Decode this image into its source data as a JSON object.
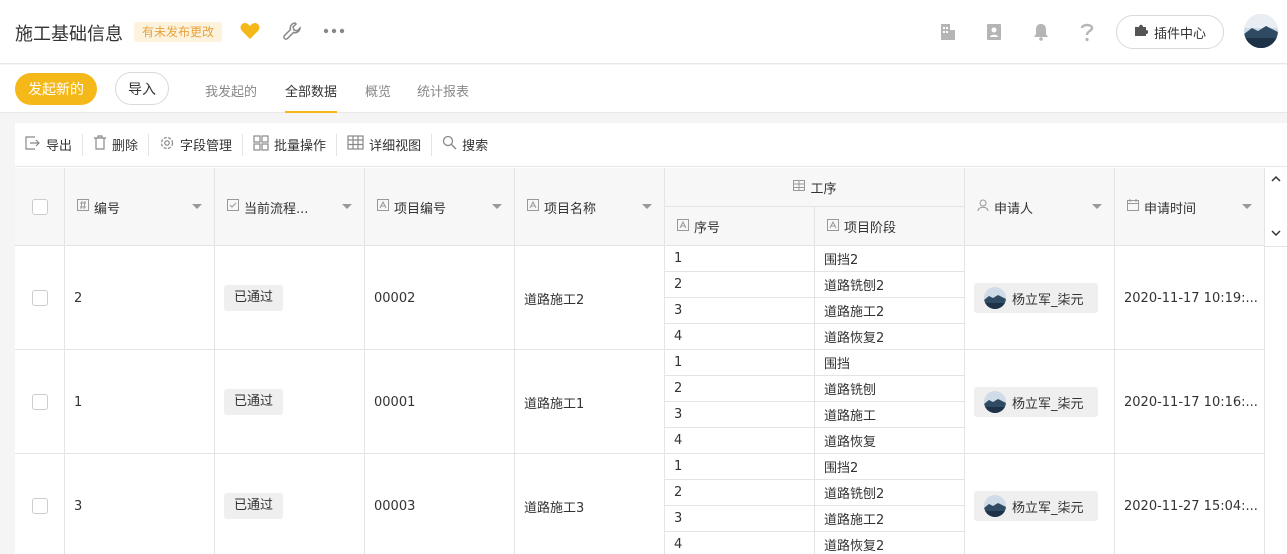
{
  "app": {
    "title": "施工基础信息",
    "badge": "有未发布更改",
    "plugin_label": "插件中心"
  },
  "nav": {
    "new_button": "发起新的",
    "import_button": "导入",
    "tabs": [
      {
        "label": "我发起的",
        "active": false
      },
      {
        "label": "全部数据",
        "active": true
      },
      {
        "label": "概览",
        "active": false
      },
      {
        "label": "统计报表",
        "active": false
      }
    ]
  },
  "toolbar": {
    "export": "导出",
    "delete": "删除",
    "fields": "字段管理",
    "batch": "批量操作",
    "detail_view": "详细视图",
    "search": "搜索"
  },
  "table": {
    "headers": {
      "id": "编号",
      "flow": "当前流程...",
      "project_no": "项目编号",
      "project_name": "项目名称",
      "process": "工序",
      "seq": "序号",
      "stage": "项目阶段",
      "applicant": "申请人",
      "apply_time": "申请时间"
    },
    "rows": [
      {
        "id": "2",
        "status": "已通过",
        "project_no": "00002",
        "project_name": "道路施工2",
        "steps": [
          {
            "seq": "1",
            "stage": "围挡2"
          },
          {
            "seq": "2",
            "stage": "道路铣刨2"
          },
          {
            "seq": "3",
            "stage": "道路施工2"
          },
          {
            "seq": "4",
            "stage": "道路恢复2"
          }
        ],
        "applicant": "杨立军_柒元",
        "time": "2020-11-17 10:19:..."
      },
      {
        "id": "1",
        "status": "已通过",
        "project_no": "00001",
        "project_name": "道路施工1",
        "steps": [
          {
            "seq": "1",
            "stage": "围挡"
          },
          {
            "seq": "2",
            "stage": "道路铣刨"
          },
          {
            "seq": "3",
            "stage": "道路施工"
          },
          {
            "seq": "4",
            "stage": "道路恢复"
          }
        ],
        "applicant": "杨立军_柒元",
        "time": "2020-11-17 10:16:..."
      },
      {
        "id": "3",
        "status": "已通过",
        "project_no": "00003",
        "project_name": "道路施工3",
        "steps": [
          {
            "seq": "1",
            "stage": "围挡2"
          },
          {
            "seq": "2",
            "stage": "道路铣刨2"
          },
          {
            "seq": "3",
            "stage": "道路施工2"
          },
          {
            "seq": "4",
            "stage": "道路恢复2"
          }
        ],
        "applicant": "杨立军_柒元",
        "time": "2020-11-27 15:04:..."
      }
    ]
  },
  "colors": {
    "accent": "#f5b819",
    "badge_text": "#e6a23c",
    "heart": "#f5b819"
  },
  "icons": [
    "heart-icon",
    "wrench-icon",
    "more-icon",
    "building-icon",
    "contacts-icon",
    "bell-icon",
    "help-icon",
    "puzzle-icon"
  ]
}
